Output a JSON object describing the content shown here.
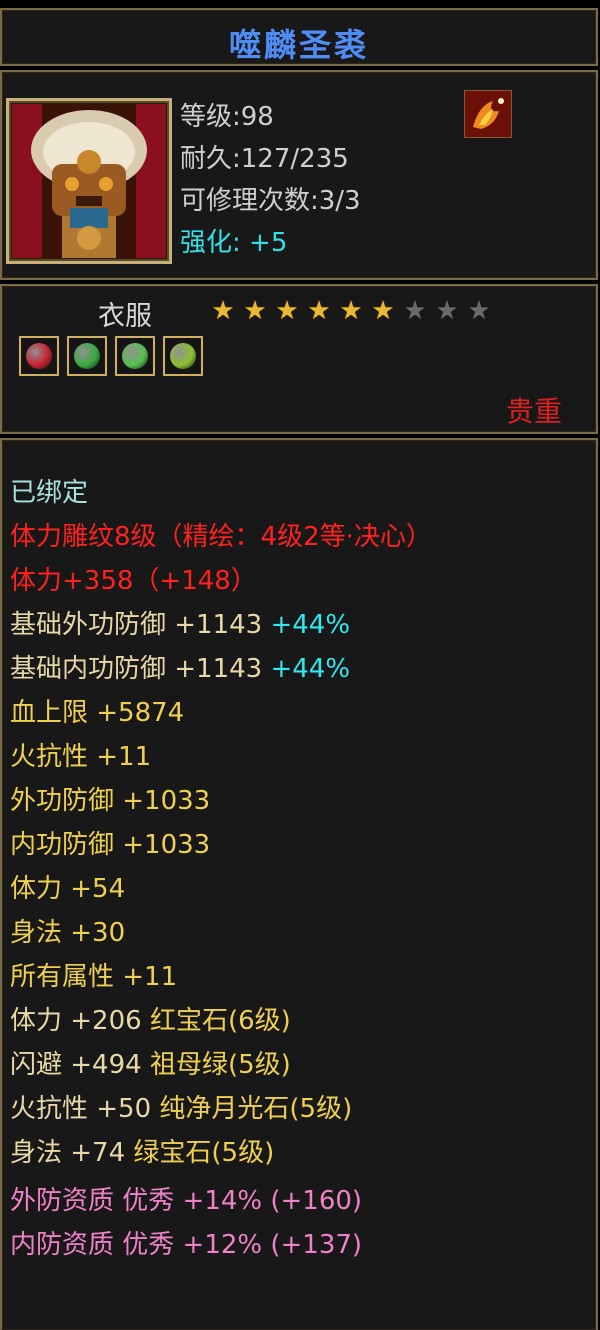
{
  "item": {
    "name": "噬麟圣裘",
    "level_line": "等级:98",
    "durability_line": "耐久:127/235",
    "repair_line": "可修理次数:3/3",
    "enhance_label": "强化:",
    "enhance_value": "+5",
    "slot": "衣服",
    "stars_total": 9,
    "stars_filled": 6,
    "rarity": "贵重"
  },
  "colors": {
    "title": "#4f8df5",
    "border": "#7a6a48",
    "red": "#ff2020",
    "cyan": "#30e8f0",
    "yellow": "#f0d050",
    "tan": "#e8d8a8",
    "pink": "#f080c8",
    "star_on": "#e8b830",
    "star_off": "#6b6b6b"
  },
  "gems": [
    {
      "name": "red-gem-icon",
      "color": "#c82030"
    },
    {
      "name": "green-gem-icon",
      "color": "#3aa840"
    },
    {
      "name": "leaf-gem-icon",
      "color": "#58c050"
    },
    {
      "name": "moonstone-gem-icon",
      "color": "#8ac030"
    }
  ],
  "stats": {
    "bound": "已绑定",
    "engraving": "体力雕纹8级（精绘：4级2等·决心）",
    "stamina_main": "体力+358（+148）",
    "base_ext_def": {
      "text": "基础外功防御 +1143 ",
      "pct": "+44%"
    },
    "base_int_def": {
      "text": "基础内功防御 +1143 ",
      "pct": "+44%"
    },
    "hp": "血上限 +5874",
    "fire_res": "火抗性 +11",
    "ext_def": "外功防御 +1033",
    "int_def": "内功防御 +1033",
    "stamina": "体力 +54",
    "agility": "身法 +30",
    "all_attr": "所有属性 +11",
    "gem1": {
      "text": "体力 +206 ",
      "gem": "红宝石(6级)"
    },
    "gem2": {
      "text": "闪避 +494 ",
      "gem": "祖母绿(5级)"
    },
    "gem3": {
      "text": "火抗性 +50 ",
      "gem": "纯净月光石(5级)"
    },
    "gem4": {
      "text": "身法 +74 ",
      "gem": "绿宝石(5级)"
    },
    "quality_ext": "外防资质  优秀 +14% (+160)",
    "quality_int": "内防资质  优秀 +12% (+137)"
  }
}
